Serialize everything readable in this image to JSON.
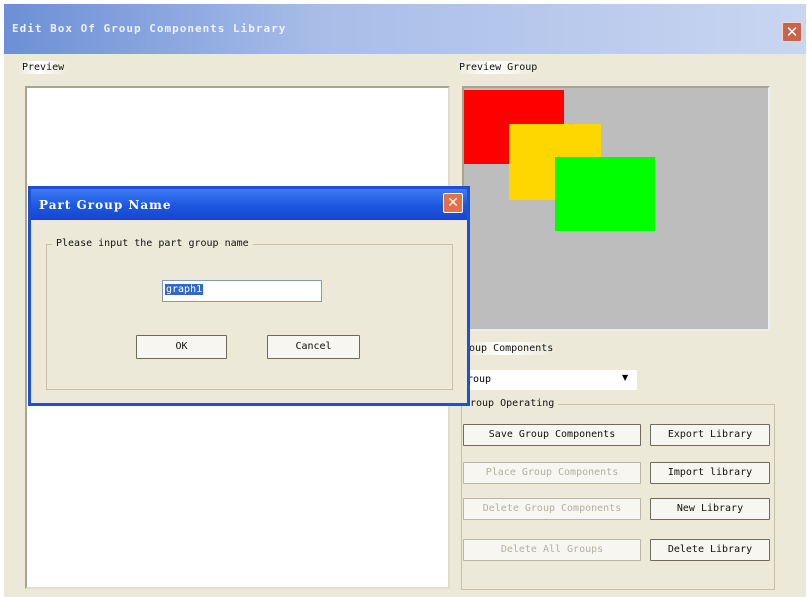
{
  "window": {
    "title": "Edit Box Of Group Components Library"
  },
  "preview": {
    "label": "Preview"
  },
  "preview_group": {
    "label": "Preview Group",
    "squares": [
      {
        "color": "#ff0000"
      },
      {
        "color": "#ffd700"
      },
      {
        "color": "#00ff00"
      }
    ]
  },
  "group_components": {
    "label": "oup Components",
    "selected": "roup"
  },
  "group_operating": {
    "label": "roup Operating",
    "buttons": {
      "save": "Save Group Components",
      "export": "Export Library",
      "place": "Place Group Components",
      "import": "Import library",
      "delete_group": "Delete Group Components",
      "new_library": "New Library",
      "delete_all": "Delete All Groups",
      "delete_library": "Delete Library"
    }
  },
  "dialog": {
    "title": "Part Group Name",
    "group_label": "Please input the part group name",
    "input_value": "graph1",
    "ok": "OK",
    "cancel": "Cancel"
  }
}
